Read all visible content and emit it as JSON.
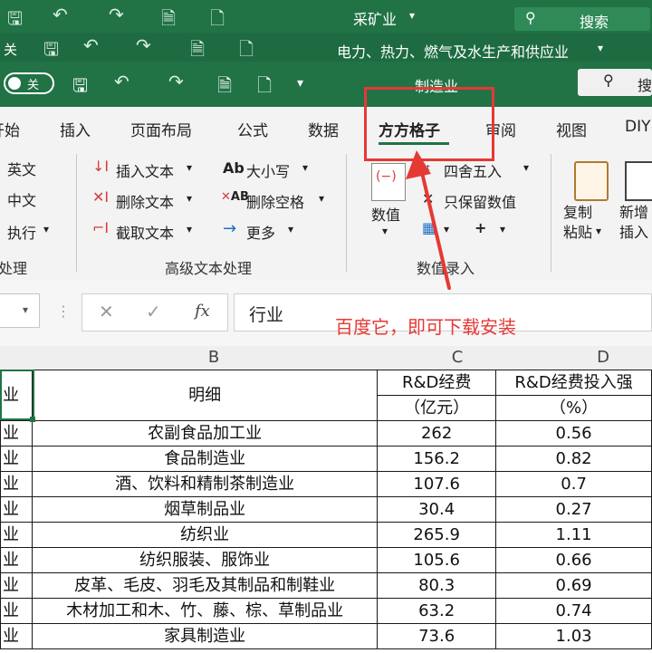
{
  "windows": [
    {
      "title": "采矿业",
      "search": "搜索"
    },
    {
      "title": "电力、热力、燃气及水生产和供应业",
      "toggle_label": "关"
    },
    {
      "title": "制造业",
      "search": "搜",
      "toggle_label": "关"
    }
  ],
  "tabs": [
    "开始",
    "插入",
    "页面布局",
    "公式",
    "数据",
    "方方格子",
    "审阅",
    "视图",
    "DIY"
  ],
  "active_tab": "方方格子",
  "ribbon": {
    "left_group": {
      "items": [
        "英文",
        "中文",
        "执行"
      ],
      "label": "处理"
    },
    "advanced_text": {
      "items": [
        "插入文本",
        "删除文本",
        "截取文本",
        "大小写",
        "删除空格",
        "更多"
      ],
      "label": "高级文本处理"
    },
    "value_entry": {
      "big_button": "数值",
      "items": [
        "四舍五入",
        "只保留数值"
      ],
      "label": "数值录入"
    },
    "copy_paste": "复制粘贴",
    "new_insert": "新增插入"
  },
  "formula_bar": {
    "fx": "fx",
    "value": "行业"
  },
  "annotation": "百度它，即可下载安装",
  "grid": {
    "columns": [
      "B",
      "C",
      "D"
    ],
    "header_row1": [
      "业",
      "明细",
      "R&D经费",
      "R&D经费投入强"
    ],
    "header_row2": [
      "（亿元）",
      "（%）"
    ],
    "rows": [
      [
        "业",
        "农副食品加工业",
        "262",
        "0.56"
      ],
      [
        "业",
        "食品制造业",
        "156.2",
        "0.82"
      ],
      [
        "业",
        "酒、饮料和精制茶制造业",
        "107.6",
        "0.7"
      ],
      [
        "业",
        "烟草制品业",
        "30.4",
        "0.27"
      ],
      [
        "业",
        "纺织业",
        "265.9",
        "1.11"
      ],
      [
        "业",
        "纺织服装、服饰业",
        "105.6",
        "0.66"
      ],
      [
        "业",
        "皮革、毛皮、羽毛及其制品和制鞋业",
        "80.3",
        "0.69"
      ],
      [
        "业",
        "木材加工和木、竹、藤、棕、草制品业",
        "63.2",
        "0.74"
      ],
      [
        "业",
        "家具制造业",
        "73.6",
        "1.03"
      ]
    ]
  },
  "colors": {
    "excel_green": "#217346",
    "annotation_red": "#e53935"
  }
}
